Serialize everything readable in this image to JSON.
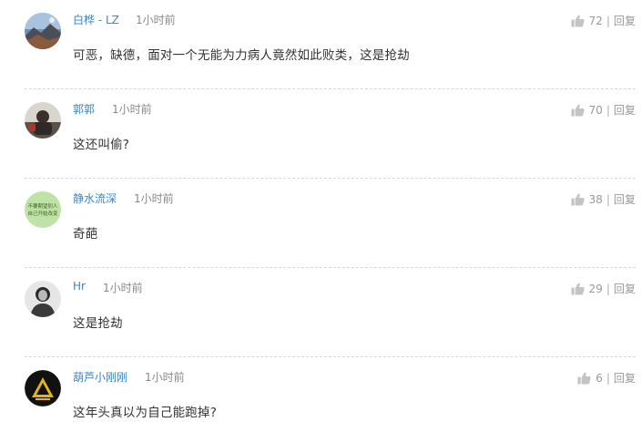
{
  "comments": [
    {
      "user": "白桦 - LZ",
      "time": "1小时前",
      "text": "可恶，缺德，面对一个无能为力病人竟然如此败类，这是抢劫",
      "likes": "72",
      "reply": "回复",
      "sep": "|"
    },
    {
      "user": "郭郭",
      "time": "1小时前",
      "text": "这还叫偷?",
      "likes": "70",
      "reply": "回复",
      "sep": "|"
    },
    {
      "user": "静水流深",
      "time": "1小时前",
      "text": "奇葩",
      "likes": "38",
      "reply": "回复",
      "sep": "|",
      "avatar_text": "不要期望別人 自己开始改变"
    },
    {
      "user": "Hr",
      "time": "1小时前",
      "text": "这是抢劫",
      "likes": "29",
      "reply": "回复",
      "sep": "|"
    },
    {
      "user": "葫芦小刚刚",
      "time": "1小时前",
      "text": "这年头真以为自己能跑掉?",
      "likes": "6",
      "reply": "回复",
      "sep": "|"
    }
  ],
  "colors": {
    "username": "#3a86c8",
    "meta": "#888888",
    "divider": "#d8d8d8"
  },
  "icons": {
    "like": "thumbs-up-icon"
  }
}
